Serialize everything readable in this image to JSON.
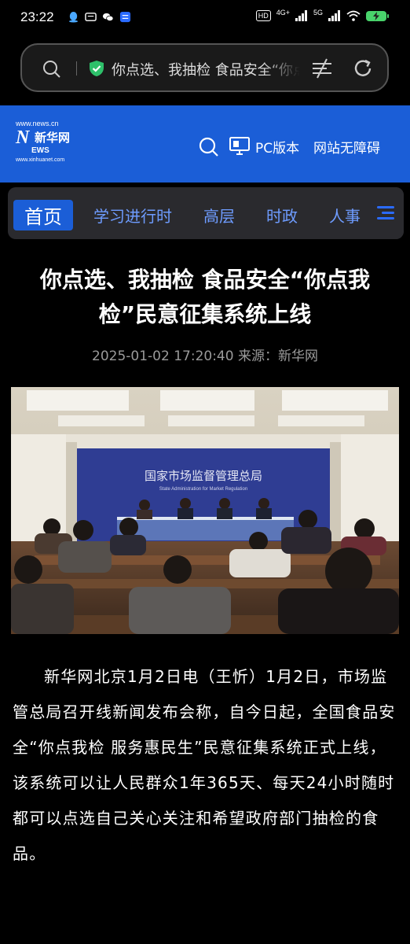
{
  "status_bar": {
    "time": "23:22",
    "hd": "HD",
    "net": "4G+",
    "net2": "5G",
    "battery_color": "#49d36b"
  },
  "address_bar": {
    "url_text": "你点选、我抽检 食品安全“你点我检”民意征集系统上线"
  },
  "site_header": {
    "logo_top": "www.news.cn",
    "logo_main": "N",
    "logo_cn": "新华网",
    "logo_ews": "EWS",
    "logo_bottom": "www.xinhuanet.com",
    "pc_version": "PC版本",
    "accessibility": "网站无障碍",
    "brand_color": "#1b5ed7"
  },
  "nav": {
    "tabs": [
      {
        "label": "首页",
        "active": true
      },
      {
        "label": "学习进行时",
        "active": false
      },
      {
        "label": "高层",
        "active": false
      },
      {
        "label": "时政",
        "active": false
      },
      {
        "label": "人事",
        "active": false
      }
    ]
  },
  "article": {
    "title": "你点选、我抽检 食品安全“你点我检”民意征集系统上线",
    "datetime": "2025-01-02 17:20:40",
    "source": "来源：新华网",
    "photo": {
      "banner_cn": "国家市场监督管理总局",
      "banner_en": "State Administration for Market Regulation"
    },
    "body": "新华网北京1月2日电（王忻）1月2日，市场监管总局召开线新闻发布会称，自今日起，全国食品安全“你点我检 服务惠民生”民意征集系统正式上线，该系统可以让人民群众1年365天、每天24小时随时都可以点选自己关心关注和希望政府部门抽检的食品。"
  }
}
